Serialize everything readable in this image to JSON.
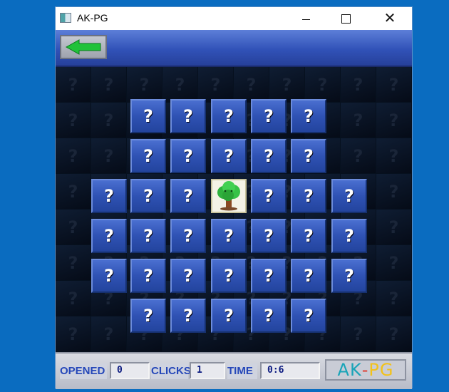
{
  "window": {
    "title": "AK-PG"
  },
  "toolbar": {
    "back_icon": "arrow-left-icon",
    "back_color": "#21c23a"
  },
  "board": {
    "background_glyph": "?",
    "tile_glyph": "?",
    "opened_tile": {
      "row": 3,
      "col": 4,
      "icon": "tree-icon"
    },
    "rows": [
      [
        0,
        0,
        0,
        0,
        0,
        0,
        0,
        0,
        0,
        0
      ],
      [
        0,
        0,
        1,
        1,
        1,
        1,
        1,
        0,
        0,
        0
      ],
      [
        0,
        0,
        1,
        1,
        1,
        1,
        1,
        0,
        0,
        0
      ],
      [
        0,
        1,
        1,
        1,
        2,
        1,
        1,
        1,
        0,
        0
      ],
      [
        0,
        1,
        1,
        1,
        1,
        1,
        1,
        1,
        0,
        0
      ],
      [
        0,
        1,
        1,
        1,
        1,
        1,
        1,
        1,
        0,
        0
      ],
      [
        0,
        0,
        1,
        1,
        1,
        1,
        1,
        0,
        0,
        0
      ],
      [
        0,
        0,
        0,
        0,
        0,
        0,
        0,
        0,
        0,
        0
      ]
    ]
  },
  "status": {
    "opened_label": "OPENED",
    "opened_value": "0",
    "clicks_label": "CLICKS",
    "clicks_value": "1",
    "time_label": "TIME",
    "time_value": "0:6",
    "logo_parts": [
      {
        "text": "AK",
        "color": "#19a4b8"
      },
      {
        "text": "-",
        "color": "#e03a2e"
      },
      {
        "text": "PG",
        "color": "#f2c21a"
      }
    ]
  }
}
